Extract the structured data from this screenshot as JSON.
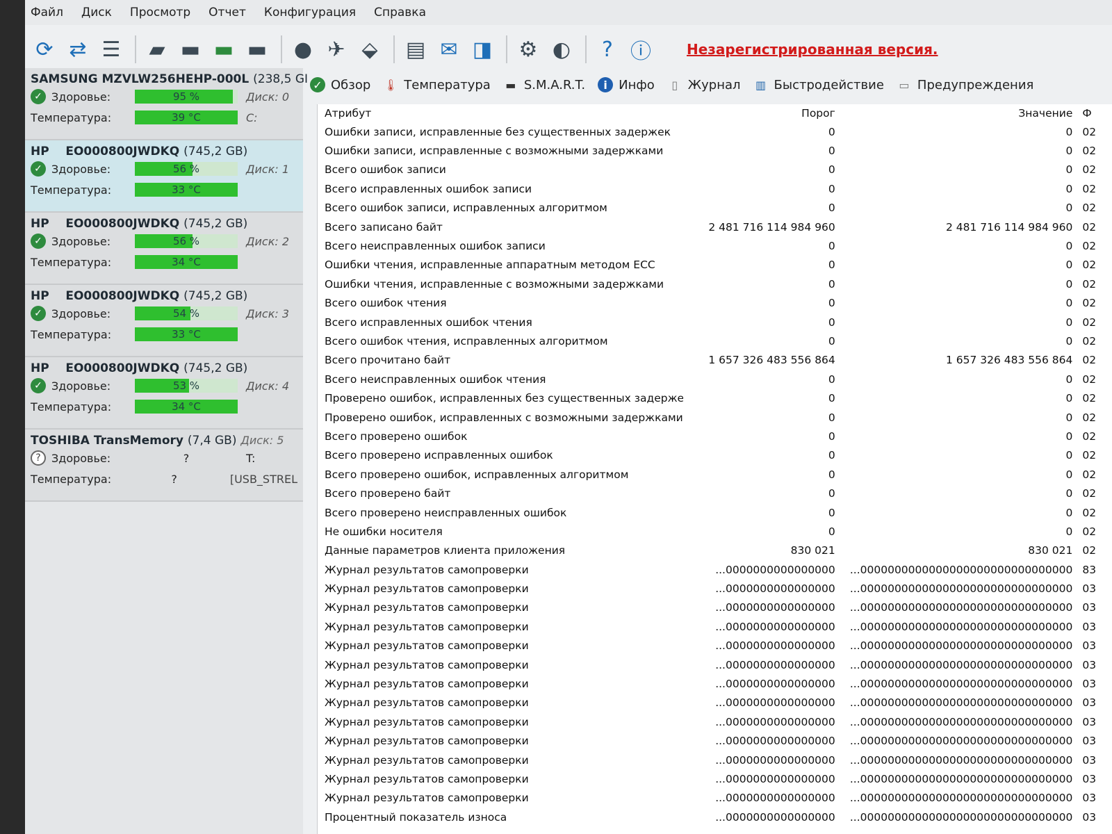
{
  "menu": [
    "Файл",
    "Диск",
    "Просмотр",
    "Отчет",
    "Конфигурация",
    "Справка"
  ],
  "toolbar": {
    "icons": [
      "refresh-icon",
      "refresh-all-icon",
      "list-icon",
      "hdd-tool-1-icon",
      "hdd-tool-2-icon",
      "hdd-tool-3-icon",
      "hdd-tool-4-icon",
      "disk-icon",
      "satellite-icon",
      "network-icon",
      "report-icon",
      "mail-icon",
      "chart-icon",
      "gear-icon",
      "sound-icon",
      "help-icon",
      "info-icon"
    ],
    "unregistered": "Незарегистрированная версия."
  },
  "disks": [
    {
      "model": "SAMSUNG MZVLW256HEHP-000L",
      "size": "(238,5 GI",
      "health_label": "Здоровье:",
      "health": "95 %",
      "health_pct": 95,
      "temp_label": "Температура:",
      "temp": "39 °C",
      "temp_pct": 100,
      "note1": "Диск: 0",
      "note2": "C:",
      "selected": false,
      "known": true
    },
    {
      "model": "HP    EO000800JWDKQ",
      "size": "(745,2 GB)",
      "health_label": "Здоровье:",
      "health": "56 %",
      "health_pct": 56,
      "temp_label": "Температура:",
      "temp": "33 °C",
      "temp_pct": 100,
      "note1": "Диск: 1",
      "note2": "",
      "selected": true,
      "known": true
    },
    {
      "model": "HP    EO000800JWDKQ",
      "size": "(745,2 GB)",
      "health_label": "Здоровье:",
      "health": "56 %",
      "health_pct": 56,
      "temp_label": "Температура:",
      "temp": "34 °C",
      "temp_pct": 100,
      "note1": "Диск: 2",
      "note2": "",
      "selected": false,
      "known": true
    },
    {
      "model": "HP    EO000800JWDKQ",
      "size": "(745,2 GB)",
      "health_label": "Здоровье:",
      "health": "54 %",
      "health_pct": 54,
      "temp_label": "Температура:",
      "temp": "33 °C",
      "temp_pct": 100,
      "note1": "Диск: 3",
      "note2": "",
      "selected": false,
      "known": true
    },
    {
      "model": "HP    EO000800JWDKQ",
      "size": "(745,2 GB)",
      "health_label": "Здоровье:",
      "health": "53 %",
      "health_pct": 53,
      "temp_label": "Температура:",
      "temp": "34 °C",
      "temp_pct": 100,
      "note1": "Диск: 4",
      "note2": "",
      "selected": false,
      "known": true
    },
    {
      "model": "TOSHIBA TransMemory",
      "size": "(7,4 GB)",
      "disknum": "Диск: 5",
      "health_label": "Здоровье:",
      "health": "?",
      "temp_label": "Температура:",
      "temp": "?",
      "note1": "T:",
      "note2": "[USB_STREL",
      "selected": false,
      "known": false
    }
  ],
  "tabs": [
    {
      "label": "Обзор",
      "icon": "check-icon"
    },
    {
      "label": "Температура",
      "icon": "thermometer-icon"
    },
    {
      "label": "S.M.A.R.T.",
      "icon": "dash-icon"
    },
    {
      "label": "Инфо",
      "icon": "info-icon"
    },
    {
      "label": "Журнал",
      "icon": "document-icon"
    },
    {
      "label": "Быстродействие",
      "icon": "chart-icon"
    },
    {
      "label": "Предупреждения",
      "icon": "warnings-icon"
    }
  ],
  "table": {
    "headers": {
      "attr": "Атрибут",
      "thr": "Порог",
      "val": "Значение",
      "flag": "Ф"
    },
    "rows": [
      [
        "Ошибки записи, исправленные без существенных задержек",
        "0",
        "0",
        "02"
      ],
      [
        "Ошибки записи, исправленные с возможными задержками",
        "0",
        "0",
        "02"
      ],
      [
        "Всего ошибок записи",
        "0",
        "0",
        "02"
      ],
      [
        "Всего исправленных ошибок записи",
        "0",
        "0",
        "02"
      ],
      [
        "Всего ошибок записи, исправленных алгоритмом",
        "0",
        "0",
        "02"
      ],
      [
        "Всего записано байт",
        "2 481 716 114 984 960",
        "2 481 716 114 984 960",
        "02"
      ],
      [
        "Всего неисправленных ошибок записи",
        "0",
        "0",
        "02"
      ],
      [
        "Ошибки чтения, исправленные аппаратным методом ECC",
        "0",
        "0",
        "02"
      ],
      [
        "Ошибки чтения, исправленные с возможными задержками",
        "0",
        "0",
        "02"
      ],
      [
        "Всего ошибок чтения",
        "0",
        "0",
        "02"
      ],
      [
        "Всего исправленных ошибок чтения",
        "0",
        "0",
        "02"
      ],
      [
        "Всего ошибок чтения, исправленных алгоритмом",
        "0",
        "0",
        "02"
      ],
      [
        "Всего прочитано байт",
        "1 657 326 483 556 864",
        "1 657 326 483 556 864",
        "02"
      ],
      [
        "Всего неисправленных ошибок чтения",
        "0",
        "0",
        "02"
      ],
      [
        "Проверено ошибок, исправленных без существенных задержек",
        "0",
        "0",
        "02"
      ],
      [
        "Проверено ошибок, исправленных с возможными задержками",
        "0",
        "0",
        "02"
      ],
      [
        "Всего проверено ошибок",
        "0",
        "0",
        "02"
      ],
      [
        "Всего проверено исправленных ошибок",
        "0",
        "0",
        "02"
      ],
      [
        "Всего проверено ошибок, исправленных алгоритмом",
        "0",
        "0",
        "02"
      ],
      [
        "Всего проверено байт",
        "0",
        "0",
        "02"
      ],
      [
        "Всего проверено неисправленных ошибок",
        "0",
        "0",
        "02"
      ],
      [
        "Не ошибки носителя",
        "0",
        "0",
        "02"
      ],
      [
        "Данные параметров клиента приложения",
        "830 021",
        "830 021",
        "02"
      ],
      [
        "Журнал результатов самопроверки",
        "...0000000000000000",
        "...0000000000000000000000000000000",
        "83"
      ],
      [
        "Журнал результатов самопроверки",
        "...0000000000000000",
        "...0000000000000000000000000000000",
        "03"
      ],
      [
        "Журнал результатов самопроверки",
        "...0000000000000000",
        "...0000000000000000000000000000000",
        "03"
      ],
      [
        "Журнал результатов самопроверки",
        "...0000000000000000",
        "...0000000000000000000000000000000",
        "03"
      ],
      [
        "Журнал результатов самопроверки",
        "...0000000000000000",
        "...0000000000000000000000000000000",
        "03"
      ],
      [
        "Журнал результатов самопроверки",
        "...0000000000000000",
        "...0000000000000000000000000000000",
        "03"
      ],
      [
        "Журнал результатов самопроверки",
        "...0000000000000000",
        "...0000000000000000000000000000000",
        "03"
      ],
      [
        "Журнал результатов самопроверки",
        "...0000000000000000",
        "...0000000000000000000000000000000",
        "03"
      ],
      [
        "Журнал результатов самопроверки",
        "...0000000000000000",
        "...0000000000000000000000000000000",
        "03"
      ],
      [
        "Журнал результатов самопроверки",
        "...0000000000000000",
        "...0000000000000000000000000000000",
        "03"
      ],
      [
        "Журнал результатов самопроверки",
        "...0000000000000000",
        "...0000000000000000000000000000000",
        "03"
      ],
      [
        "Журнал результатов самопроверки",
        "...0000000000000000",
        "...0000000000000000000000000000000",
        "03"
      ],
      [
        "Журнал результатов самопроверки",
        "...0000000000000000",
        "...0000000000000000000000000000000",
        "03"
      ],
      [
        "Процентный показатель износа",
        "...0000000000000000",
        "...0000000000000000000000000000000",
        "03"
      ]
    ]
  }
}
